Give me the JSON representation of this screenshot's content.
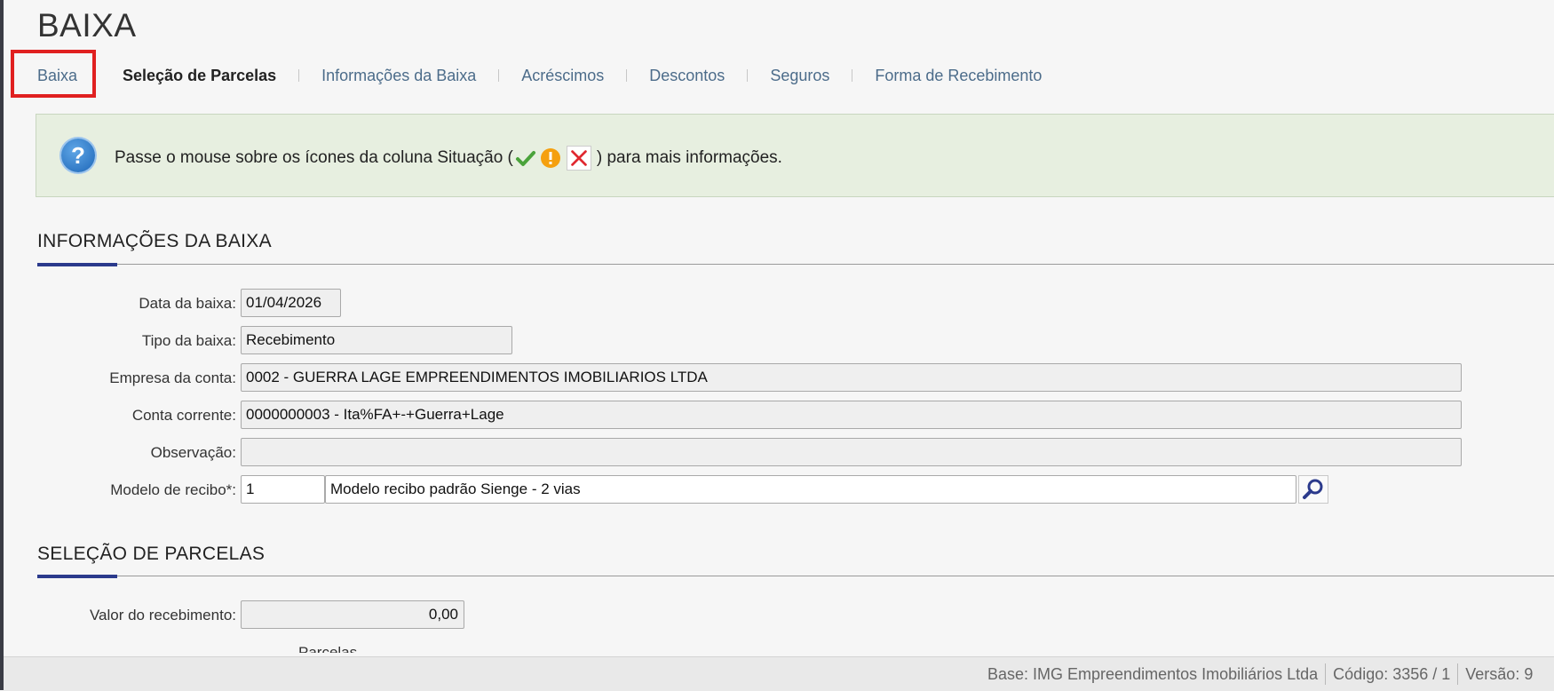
{
  "page": {
    "title": "BAIXA"
  },
  "tabs": [
    {
      "label": "Baixa"
    },
    {
      "label": "Seleção de Parcelas"
    },
    {
      "label": "Informações da Baixa"
    },
    {
      "label": "Acréscimos"
    },
    {
      "label": "Descontos"
    },
    {
      "label": "Seguros"
    },
    {
      "label": "Forma de Recebimento"
    }
  ],
  "info": {
    "text_before": "Passe o mouse sobre os ícones da coluna Situação (",
    "text_after": ") para mais informações.",
    "icons": [
      "help-icon",
      "check-icon",
      "warning-icon",
      "x-icon"
    ]
  },
  "section1": {
    "title": "INFORMAÇÕES DA BAIXA",
    "fields": {
      "data_label": "Data da baixa:",
      "data_value": "01/04/2026",
      "tipo_label": "Tipo da baixa:",
      "tipo_value": "Recebimento",
      "empresa_label": "Empresa da conta:",
      "empresa_value": "0002 - GUERRA LAGE EMPREENDIMENTOS IMOBILIARIOS LTDA",
      "conta_label": "Conta corrente:",
      "conta_value": "0000000003 - Ita%FA+-+Guerra+Lage",
      "obs_label": "Observação:",
      "obs_value": "",
      "modelo_label": "Modelo de recibo*:",
      "modelo_code": "1",
      "modelo_desc": "Modelo recibo padrão Sienge - 2 vias"
    }
  },
  "section2": {
    "title": "SELEÇÃO DE PARCELAS",
    "valor_label": "Valor do recebimento:",
    "valor_value": "0,00",
    "next_label": "Parcelas"
  },
  "status": {
    "base": "Base: IMG Empreendimentos Imobiliários Ltda",
    "codigo": "Código: 3356 / 1",
    "versao": "Versão: 9"
  },
  "colors": {
    "accent": "#2b3a8c",
    "highlight": "#e02020",
    "info_bg": "#e7efe0",
    "link": "#4c6c8a"
  }
}
